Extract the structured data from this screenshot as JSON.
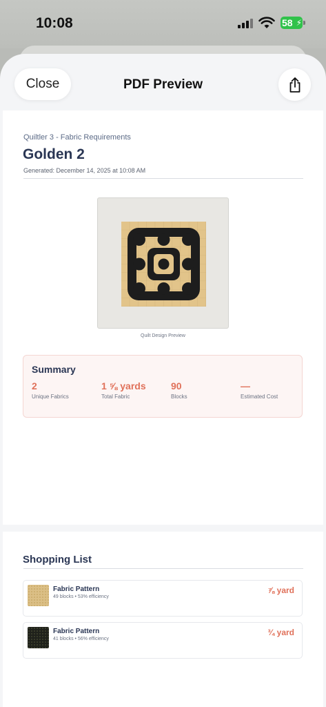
{
  "status_bar": {
    "time": "10:08",
    "battery": "58"
  },
  "nav": {
    "close_label": "Close",
    "title": "PDF Preview",
    "share_icon": "share-icon"
  },
  "document": {
    "subtitle": "Quiltler 3 - Fabric Requirements",
    "title": "Golden 2",
    "generated": "Generated: December 14, 2025 at 10:08 AM",
    "preview_caption": "Quilt Design Preview",
    "summary": {
      "title": "Summary",
      "stats": [
        {
          "value": "2",
          "label": "Unique Fabrics"
        },
        {
          "value": "1 ⅝ yards",
          "label": "Total Fabric"
        },
        {
          "value": "90",
          "label": "Blocks"
        },
        {
          "value": "—",
          "label": "Estimated Cost"
        }
      ]
    },
    "shopping_list": {
      "title": "Shopping List",
      "items": [
        {
          "name": "Fabric Pattern",
          "detail": "49 blocks • 53% efficiency",
          "quantity": "⅞ yard",
          "swatch_color": "#dbbf86"
        },
        {
          "name": "Fabric Pattern",
          "detail": "41 blocks • 56% efficiency",
          "quantity": "¾ yard",
          "swatch_color": "#1f211b"
        }
      ]
    }
  },
  "colors": {
    "accent": "#e0715a",
    "heading": "#2a3654",
    "quilt_light": "#e2c48a",
    "quilt_dark": "#1d1d1d"
  }
}
